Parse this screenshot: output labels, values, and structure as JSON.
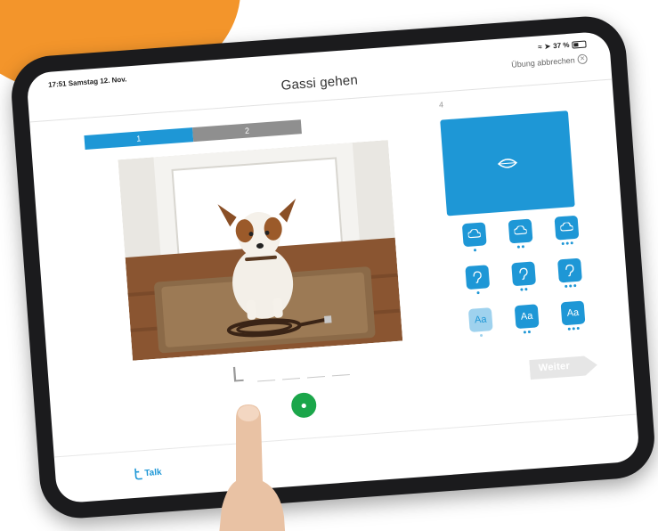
{
  "status_bar": {
    "time": "17:51",
    "date": "Samstag 12. Nov.",
    "battery": "37 %"
  },
  "header": {
    "title": "Gassi gehen",
    "abort_label": "Übung abbrechen",
    "abort_icon": "close-circle-icon"
  },
  "progress": {
    "steps": [
      "1",
      "2"
    ],
    "current_step": 1,
    "total_label": "4",
    "active_color": "#1e97d6",
    "inactive_color": "#8f8f8f"
  },
  "exercise": {
    "typed_letter": "L",
    "blank_count": 4
  },
  "options": {
    "panel_icon": "mouth-icon",
    "rows": [
      {
        "icon": "speech-cloud-icon",
        "levels": [
          1,
          2,
          3
        ]
      },
      {
        "icon": "ear-icon",
        "levels": [
          1,
          2,
          3
        ]
      },
      {
        "icon": "text-aa-icon",
        "glyph": "Aa",
        "levels": [
          1,
          2,
          3
        ],
        "selected_level": 1
      }
    ]
  },
  "actions": {
    "next_label": "Weiter",
    "mic_icon": "microphone-icon"
  },
  "branding": {
    "logo_text": "Talk"
  },
  "colors": {
    "accent": "#1e97d6",
    "mic_green": "#1ba64a",
    "bubble_orange": "#f3952b"
  }
}
